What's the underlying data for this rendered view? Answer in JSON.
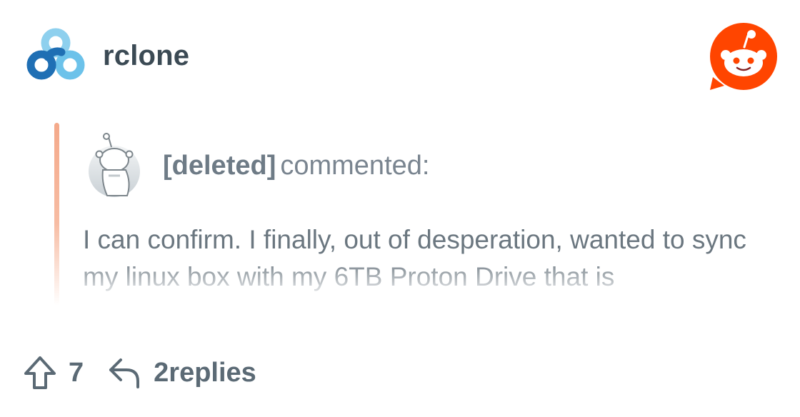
{
  "community": {
    "name": "rclone",
    "logo_icon": "rclone-logo-icon"
  },
  "brand": {
    "logo_icon": "reddit-logo-icon",
    "accent": "#ff4500"
  },
  "comment": {
    "author": "[deleted]",
    "action": "commented:",
    "avatar_icon": "snoo-avatar-icon",
    "text": "I can confirm. I finally, out of desperation, wanted to sync my linux box with my 6TB Proton Drive that is",
    "quote_bar_color": "#f4a98a"
  },
  "actions": {
    "upvote_icon": "upvote-arrow-icon",
    "vote_count": "7",
    "reply_icon": "reply-arrow-icon",
    "replies_label": "2replies"
  }
}
